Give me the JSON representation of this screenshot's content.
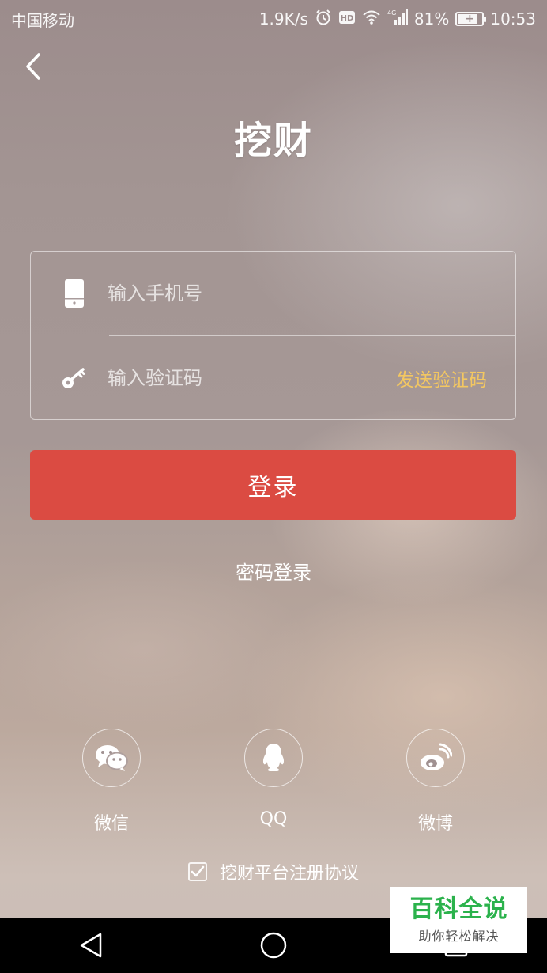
{
  "status_bar": {
    "carrier": "中国移动",
    "net_speed": "1.9K/s",
    "network_type": "4G",
    "battery_percent": "81%",
    "battery_level": 0.81,
    "time": "10:53",
    "icons": [
      "alarm-icon",
      "hd-icon",
      "wifi-icon",
      "signal-icon",
      "battery-charging-icon"
    ]
  },
  "header": {
    "back_icon": "chevron-left-icon",
    "title": "挖财"
  },
  "form": {
    "phone": {
      "icon": "phone-icon",
      "placeholder": "输入手机号",
      "value": ""
    },
    "code": {
      "icon": "key-icon",
      "placeholder": "输入验证码",
      "value": ""
    },
    "send_code_label": "发送验证码"
  },
  "login_button_label": "登录",
  "password_login_label": "密码登录",
  "social": [
    {
      "icon": "wechat-icon",
      "label": "微信"
    },
    {
      "icon": "qq-icon",
      "label": "QQ"
    },
    {
      "icon": "weibo-icon",
      "label": "微博"
    }
  ],
  "agreement": {
    "checked": true,
    "label": "挖财平台注册协议"
  },
  "navbar": {
    "icons": [
      "back-triangle-icon",
      "home-circle-icon",
      "recents-square-icon"
    ]
  },
  "watermark": {
    "title": "百科全说",
    "subtitle": "助你轻松解决"
  },
  "colors": {
    "login_button": "#db4b42",
    "send_code_text": "#f3c761",
    "watermark_title": "#2bb24c"
  }
}
